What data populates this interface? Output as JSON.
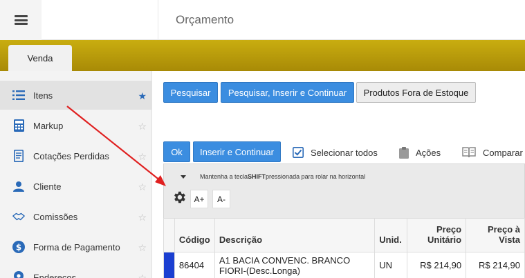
{
  "header": {
    "page_title": "Orçamento"
  },
  "tabs": [
    {
      "label": "Venda"
    }
  ],
  "sidebar": {
    "items": [
      {
        "label": "Itens",
        "icon": "list-icon",
        "active": true
      },
      {
        "label": "Markup",
        "icon": "calculator-icon",
        "active": false
      },
      {
        "label": "Cotações Perdidas",
        "icon": "document-icon",
        "active": false
      },
      {
        "label": "Cliente",
        "icon": "user-icon",
        "active": false
      },
      {
        "label": "Comissões",
        "icon": "handshake-icon",
        "active": false
      },
      {
        "label": "Forma de Pagamento",
        "icon": "dollar-icon",
        "active": false
      },
      {
        "label": "Endereços",
        "icon": "map-pin-icon",
        "active": false
      }
    ]
  },
  "toolbar": {
    "search_label": "Pesquisar",
    "search_insert_label": "Pesquisar, Inserir e Continuar",
    "out_of_stock_label": "Produtos Fora de Estoque",
    "ok_label": "Ok",
    "insert_continue_label": "Inserir e Continuar",
    "select_all_label": "Selecionar todos",
    "actions_label": "Ações",
    "compare_label": "Comparar"
  },
  "grid": {
    "hint_prefix": "Mantenha a tecla ",
    "hint_key": "SHIFT",
    "hint_suffix": " pressionada para rolar na horizontal",
    "font_increase": "A+",
    "font_decrease": "A-",
    "columns": [
      "Código",
      "Descrição",
      "Unid.",
      "Preço Unitário",
      "Preço à Vista"
    ],
    "rows": [
      {
        "codigo": "86404",
        "descricao": "A1 BACIA CONVENC. BRANCO FIORI-(Desc.Longa)",
        "unid": "UN",
        "preco_unitario": "R$ 214,90",
        "preco_vista": "R$ 214,90"
      }
    ]
  },
  "colors": {
    "accent_blue": "#3b8de0",
    "gold_strip": "#b8980b",
    "annotation_arrow": "#e02020"
  }
}
